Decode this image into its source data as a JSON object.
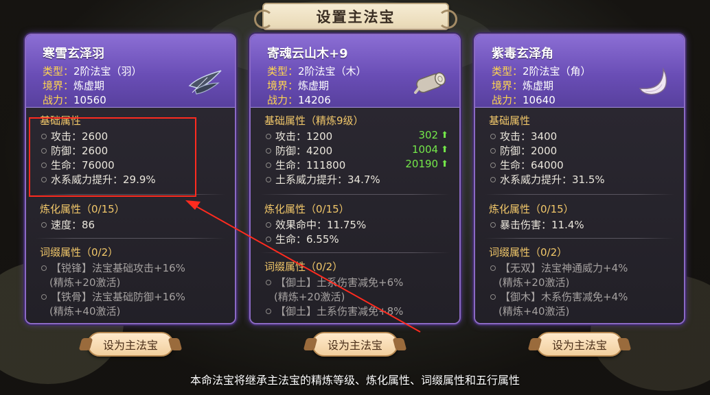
{
  "title": "设置主法宝",
  "footer": "本命法宝将继承主法宝的精炼等级、炼化属性、词缀属性和五行属性",
  "set_main_label": "设为主法宝",
  "colors": {
    "card_head": "#6a4eb6",
    "card_border": "#8b6ac4",
    "section_title": "#f2c86a",
    "meta_key": "#ffd64f",
    "gain": "#74e84a",
    "annotation": "#ff2b1f"
  },
  "cards": [
    {
      "name": "寒雪玄泽羽",
      "icon": "feather-icon",
      "type_key": "类型：",
      "type_val": "2阶法宝（羽）",
      "realm_key": "境界：",
      "realm_val": "炼虚期",
      "power_key": "战力：",
      "power_val": "10560",
      "base_title": "基础属性",
      "base": [
        "攻击：2600",
        "防御：2600",
        "生命：76000",
        "水系威力提升：29.9%"
      ],
      "refine_title": "炼化属性（0/15）",
      "refine": [
        "速度：86"
      ],
      "affix_title": "词缀属性（0/2）",
      "affix": [
        {
          "line": "【锐锋】法宝基础攻击+16%",
          "sub": "(精炼+20激活)"
        },
        {
          "line": "【铁骨】法宝基础防御+16%",
          "sub": "(精炼+40激活)"
        }
      ]
    },
    {
      "name": "寄魂云山木+9",
      "icon": "wood-log-icon",
      "type_key": "类型：",
      "type_val": "2阶法宝（木）",
      "realm_key": "境界：",
      "realm_val": "炼虚期",
      "power_key": "战力：",
      "power_val": "14206",
      "base_title": "基础属性（精炼9级）",
      "base": [
        "攻击：1200",
        "防御：4200",
        "生命：111800",
        "土系威力提升：34.7%"
      ],
      "base_gains": [
        "302",
        "1004",
        "20190"
      ],
      "refine_title": "炼化属性（0/15）",
      "refine": [
        "效果命中：11.75%",
        "生命：6.55%"
      ],
      "affix_title": "词缀属性（0/2）",
      "affix": [
        {
          "line": "【御土】土系伤害减免+6%",
          "sub": "(精炼+20激活)"
        },
        {
          "line": "【御土】土系伤害减免+8%",
          "sub": ""
        }
      ]
    },
    {
      "name": "紫毒玄泽角",
      "icon": "horn-icon",
      "type_key": "类型：",
      "type_val": "2阶法宝（角）",
      "realm_key": "境界：",
      "realm_val": "炼虚期",
      "power_key": "战力：",
      "power_val": "10640",
      "base_title": "基础属性",
      "base": [
        "攻击：3400",
        "防御：2000",
        "生命：64000",
        "水系威力提升：31.5%"
      ],
      "refine_title": "炼化属性（0/15）",
      "refine": [
        "暴击伤害：11.4%"
      ],
      "affix_title": "词缀属性（0/2）",
      "affix": [
        {
          "line": "【无双】法宝神通威力+4%",
          "sub": "(精炼+20激活)"
        },
        {
          "line": "【御木】木系伤害减免+4%",
          "sub": "(精炼+40激活)"
        }
      ]
    }
  ]
}
